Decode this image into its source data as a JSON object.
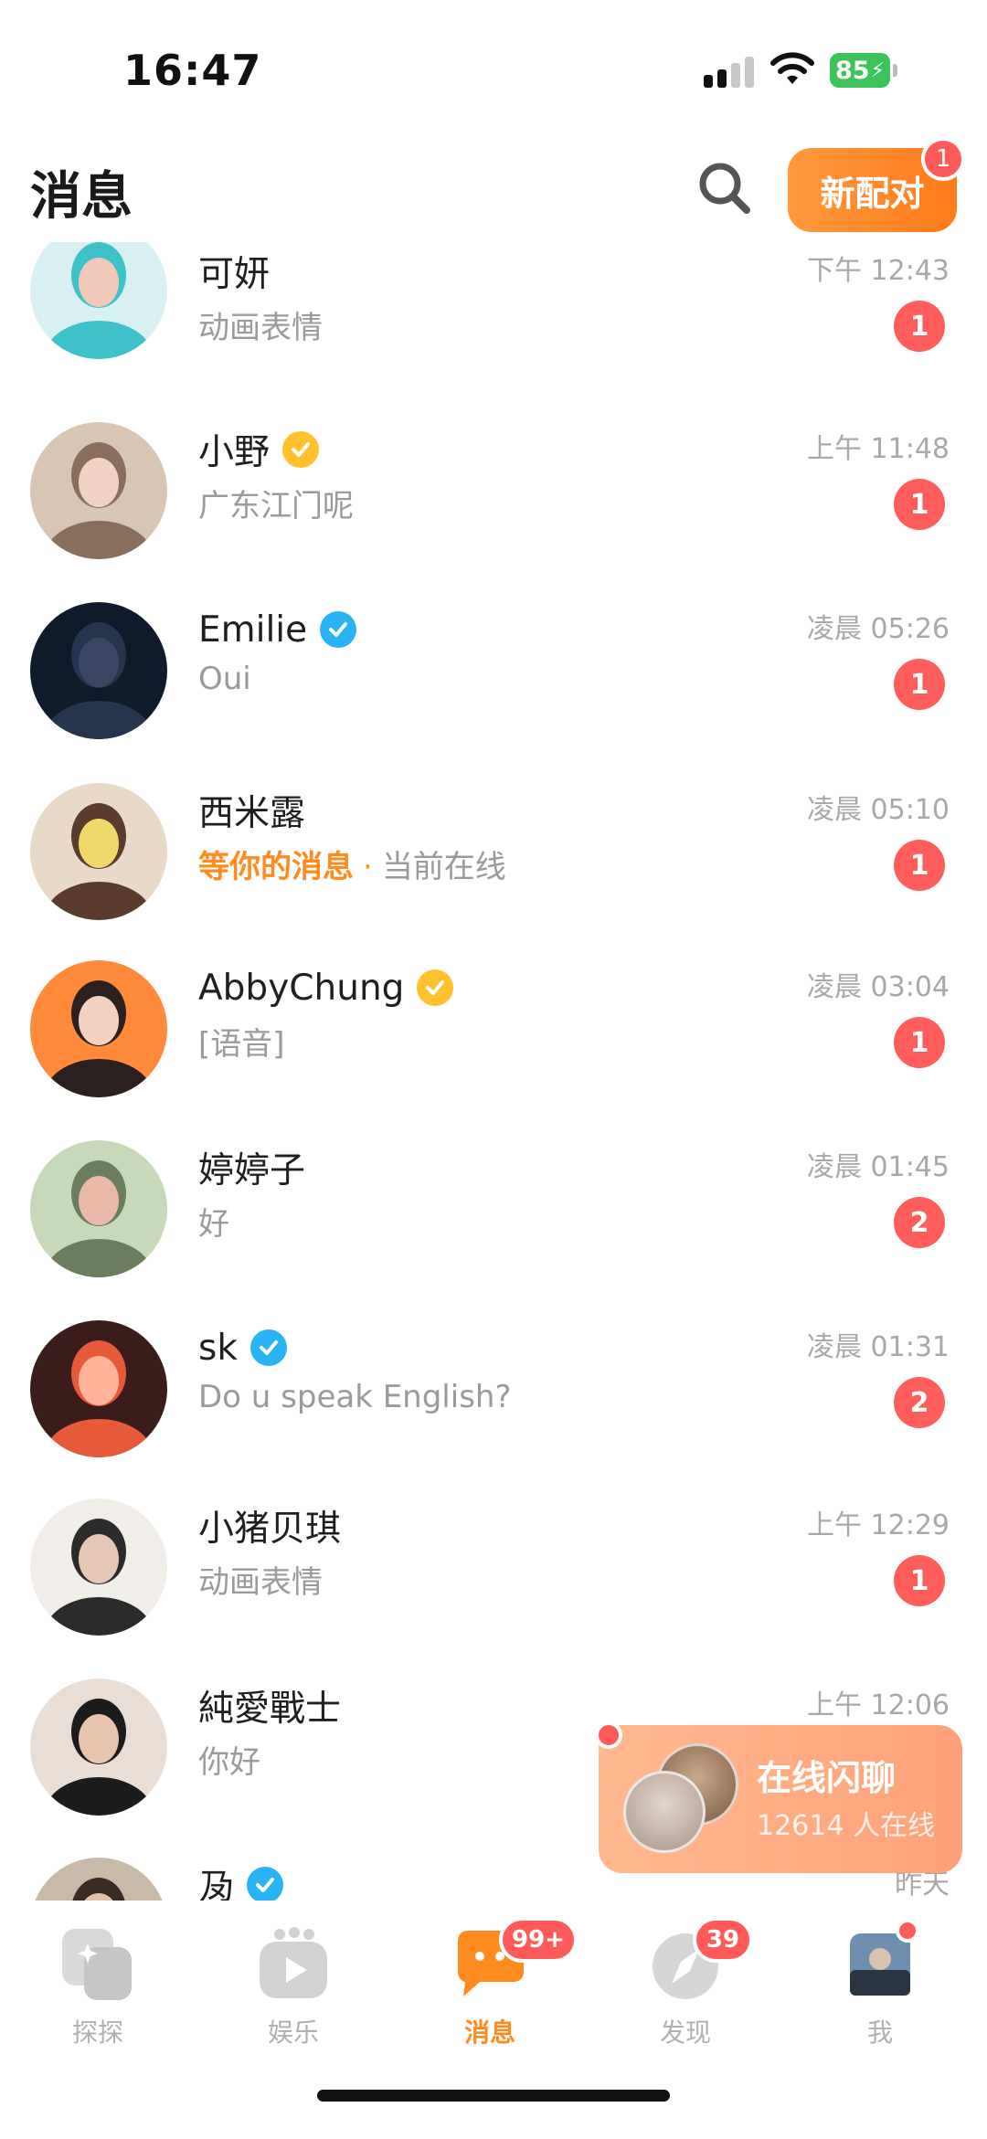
{
  "status_bar": {
    "time": "16:47",
    "battery": "85"
  },
  "header": {
    "title": "消息",
    "new_match_label": "新配对",
    "new_match_badge": "1"
  },
  "conversations": [
    {
      "name": "可妍",
      "verified": "",
      "preview": "动画表情",
      "time": "下午 12:43",
      "unread": "1",
      "avatar_colors": [
        "#d9f0f2",
        "#3fc1c9",
        "#f2c9b8"
      ]
    },
    {
      "name": "小野",
      "verified": "gold",
      "preview": "广东江门呢",
      "time": "上午 11:48",
      "unread": "1",
      "avatar_colors": [
        "#d8c5b4",
        "#8a6e5c",
        "#f1d3c4"
      ]
    },
    {
      "name": "Emilie",
      "verified": "blue",
      "preview": "Oui",
      "time": "凌晨 05:26",
      "unread": "1",
      "avatar_colors": [
        "#0f1a2b",
        "#26344d",
        "#3b4663"
      ]
    },
    {
      "name": "西米露",
      "verified": "",
      "preview_highlight": "等你的消息",
      "preview_separator": "·",
      "preview_suffix": "当前在线",
      "time": "凌晨 05:10",
      "unread": "1",
      "avatar_colors": [
        "#e9d9c9",
        "#5a3b2d",
        "#f0d86a"
      ]
    },
    {
      "name": "AbbyChung",
      "verified": "gold",
      "preview": "[语音]",
      "time": "凌晨 03:04",
      "unread": "1",
      "avatar_colors": [
        "#ff8a3a",
        "#2a2020",
        "#f4d2c2"
      ]
    },
    {
      "name": "婷婷子",
      "verified": "",
      "preview": "好",
      "time": "凌晨 01:45",
      "unread": "2",
      "avatar_colors": [
        "#c7d9b9",
        "#6b7d5c",
        "#e9b8a8"
      ]
    },
    {
      "name": "sk",
      "verified": "blue",
      "preview": "Do u speak English?",
      "time": "凌晨 01:31",
      "unread": "2",
      "avatar_colors": [
        "#3a1d1a",
        "#e65a3a",
        "#ffb39a"
      ]
    },
    {
      "name": "小猪贝琪",
      "verified": "",
      "preview": "动画表情",
      "time": "上午 12:29",
      "unread": "1",
      "avatar_colors": [
        "#f1ede8",
        "#2b2b2b",
        "#e5c8b6"
      ]
    },
    {
      "name": "純愛戰士",
      "verified": "",
      "preview": "你好",
      "time": "上午 12:06",
      "unread": "",
      "avatar_colors": [
        "#e8ded6",
        "#1c1c1c",
        "#e8c3ad"
      ]
    },
    {
      "name": "夃",
      "verified": "blue",
      "preview": "",
      "time": "昨天",
      "unread": "",
      "avatar_colors": [
        "#c9b9a9",
        "#3a2c24",
        "#e2c2aa"
      ]
    }
  ],
  "float_card": {
    "title": "在线闪聊",
    "subtitle": "12614 人在线"
  },
  "tabs": [
    {
      "label": "探探",
      "icon": "tantan-icon",
      "badge": ""
    },
    {
      "label": "娱乐",
      "icon": "play-icon",
      "badge": ""
    },
    {
      "label": "消息",
      "icon": "chat-bubble-icon",
      "badge": "99+",
      "active": true
    },
    {
      "label": "发现",
      "icon": "discover-icon",
      "badge": "39"
    },
    {
      "label": "我",
      "icon": "profile-avatar",
      "badge": ""
    }
  ],
  "colors": {
    "accent": "#ff8a1e",
    "badge": "#ff5c5c",
    "verify_gold": "#ffc22e",
    "verify_blue": "#2ab3f5"
  }
}
